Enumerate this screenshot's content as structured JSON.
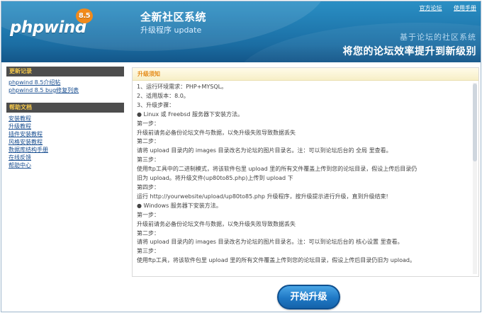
{
  "header": {
    "logo_text": "phpwind",
    "logo_version": "8.5",
    "system_title": "全新社区系统",
    "system_subtitle": "升级程序 update",
    "links": [
      "官方论坛",
      "使用手册"
    ],
    "slogan_small": "基于论坛的社区系统",
    "slogan_big": "将您的论坛效率提升到新级别"
  },
  "sidebar": {
    "updates": {
      "title": "更新记录",
      "items": [
        "phpwind 8.5介绍帖",
        "phpwind 8.5 bug修复列表"
      ]
    },
    "help": {
      "title": "帮助文档",
      "items": [
        "安装教程",
        "升级教程",
        "插件安装教程",
        "风格安装教程",
        "数据库结构手册",
        "在线反馈",
        "帮助中心"
      ]
    }
  },
  "main": {
    "title": "升级须知",
    "lines": [
      "1、运行环境需求：PHP+MYSQL。",
      "2、适用版本：8.0。",
      "3、升级步骤：",
      "● Linux 或 Freebsd 服务器下安装方法。",
      "第一步：",
      "升级前请务必备份论坛文件与数据，以免升级失败导致数据丢失",
      "第二步：",
      "请将 upload 目录内的 images 目录改名为论坛的图片目录名。注：可以到论坛后台的 全局 里查看。",
      "第三步：",
      "使用ftp工具中的二进制模式，将该软件包里 upload 里的所有文件覆盖上传到您的论坛目录，假设上传后目录仍",
      "旧为 upload。将升级文件(up80to85.php)上传到 upload 下",
      "第四步：",
      "运行 http://yourwebsite/upload/up80to85.php 升级程序，按升级提示进行升级，直到升级结束!",
      "● Windows 服务器下安装方法。",
      "第一步：",
      "升级前请务必备份论坛文件与数据，以免升级失败导致数据丢失",
      "第二步：",
      "请将 upload 目录内的 images 目录改名为论坛的图片目录名。注：可以到论坛后台的 核心设置 里查看。",
      "第三步：",
      "使用ftp工具，将该软件包里 upload 里的所有文件覆盖上传到您的论坛目录，假设上传后目录仍旧为 upload。"
    ]
  },
  "button": {
    "label": "开始升级"
  }
}
